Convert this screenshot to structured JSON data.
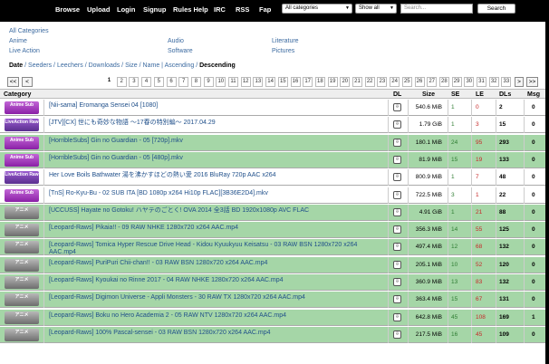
{
  "nav": {
    "items": [
      "Browse",
      "Upload",
      "Login",
      "Signup",
      "Rules Help",
      "IRC",
      "RSS",
      "Fap"
    ],
    "category_select": "All categories",
    "filter_select": "Show all",
    "search_placeholder": "Search...",
    "search_button": "Search"
  },
  "categories": {
    "all": "All Categories",
    "anime": "Anime",
    "audio": "Audio",
    "literature": "Literature",
    "live_action": "Live Action",
    "software": "Software",
    "pictures": "Pictures"
  },
  "sort": {
    "date": "Date",
    "seeders": "Seeders",
    "leechers": "Leechers",
    "downloads": "Downloads",
    "size": "Size",
    "name": "Name",
    "ascending": "Ascending",
    "descending": "Descending"
  },
  "pager": {
    "first": "<<",
    "prev": "<",
    "next": ">",
    "last": ">>",
    "pages": [
      "1",
      "2",
      "3",
      "4",
      "5",
      "6",
      "7",
      "8",
      "9",
      "10",
      "11",
      "12",
      "13",
      "14",
      "15",
      "16",
      "17",
      "18",
      "19",
      "20",
      "21",
      "22",
      "23",
      "24",
      "25",
      "26",
      "27",
      "28",
      "29",
      "30",
      "31",
      "32",
      "33"
    ]
  },
  "table": {
    "headers": {
      "category": "Category",
      "dl": "DL",
      "size": "Size",
      "se": "SE",
      "le": "LE",
      "dls": "DLs",
      "msg": "Msg"
    },
    "rows": [
      {
        "badge": "Anime Sub",
        "color": "pink",
        "name": "[Nii-sama] Eromanga Sensei 04 [1080]",
        "size": "540.6 MiB",
        "se": "1",
        "le": "0",
        "dls": "2",
        "msg": "0",
        "bg": "w"
      },
      {
        "badge": "LiveAction Raw",
        "color": "purple",
        "name": "[JTV][CX] 世にも奇妙な物語 ～17春の特別編～ 2017.04.29",
        "size": "1.79 GiB",
        "se": "1",
        "le": "3",
        "dls": "15",
        "msg": "0",
        "bg": "w"
      },
      {
        "badge": "Anime Sub",
        "color": "pink",
        "name": "[HorribleSubs] Gin no Guardian - 05 [720p].mkv",
        "size": "180.1 MiB",
        "se": "24",
        "le": "95",
        "dls": "293",
        "msg": "0",
        "bg": "g"
      },
      {
        "badge": "Anime Sub",
        "color": "pink",
        "name": "[HorribleSubs] Gin no Guardian - 05 [480p].mkv",
        "size": "81.9 MiB",
        "se": "15",
        "le": "19",
        "dls": "133",
        "msg": "0",
        "bg": "g"
      },
      {
        "badge": "LiveAction Raw",
        "color": "purple",
        "name": "Her Love Boils Bathwater 湯を沸かすほどの熱い愛 2016 BluRay 720p AAC x264",
        "size": "800.9 MiB",
        "se": "1",
        "le": "7",
        "dls": "48",
        "msg": "0",
        "bg": "w"
      },
      {
        "badge": "Anime Sub",
        "color": "pink",
        "name": "[TnS] Ro-Kyu-Bu - 02 SUB ITA [BD 1080p x264 Hi10p FLAC][3B36E2D4].mkv",
        "size": "722.5 MiB",
        "se": "3",
        "le": "1",
        "dls": "22",
        "msg": "0",
        "bg": "w"
      },
      {
        "badge": "アニメ",
        "color": "gray",
        "name": "[UCCUSS] Hayate no Gotoku! ハヤテのごとく! OVA 2014 全3話 BD 1920x1080p AVC FLAC",
        "size": "4.91 GiB",
        "se": "1",
        "le": "21",
        "dls": "88",
        "msg": "0",
        "bg": "g"
      },
      {
        "badge": "アニメ",
        "color": "gray",
        "name": "[Leopard-Raws] Pikaia!! - 09 RAW NHKE 1280x720 x264 AAC.mp4",
        "size": "356.3 MiB",
        "se": "14",
        "le": "55",
        "dls": "125",
        "msg": "0",
        "bg": "g"
      },
      {
        "badge": "アニメ",
        "color": "gray",
        "name": "[Leopard-Raws] Tomica Hyper Rescue Drive Head - Kidou Kyuukyuu Keisatsu - 03 RAW BSN 1280x720 x264 AAC.mp4",
        "size": "497.4 MiB",
        "se": "12",
        "le": "68",
        "dls": "132",
        "msg": "0",
        "bg": "g"
      },
      {
        "badge": "アニメ",
        "color": "gray",
        "name": "[Leopard-Raws] PuriPuri Chii-chan!! - 03 RAW BSN 1280x720 x264 AAC.mp4",
        "size": "205.1 MiB",
        "se": "10",
        "le": "52",
        "dls": "120",
        "msg": "0",
        "bg": "g"
      },
      {
        "badge": "アニメ",
        "color": "gray",
        "name": "[Leopard-Raws] Kyoukai no Rinne 2017 - 04 RAW NHKE 1280x720 x264 AAC.mp4",
        "size": "360.9 MiB",
        "se": "13",
        "le": "83",
        "dls": "132",
        "msg": "0",
        "bg": "g"
      },
      {
        "badge": "アニメ",
        "color": "gray",
        "name": "[Leopard-Raws] Digimon Universe - Appli Monsters - 30 RAW TX 1280x720 x264 AAC.mp4",
        "size": "363.4 MiB",
        "se": "15",
        "le": "67",
        "dls": "131",
        "msg": "0",
        "bg": "g"
      },
      {
        "badge": "アニメ",
        "color": "gray",
        "name": "[Leopard-Raws] Boku no Hero Academia 2 - 05 RAW NTV 1280x720 x264 AAC.mp4",
        "size": "642.8 MiB",
        "se": "45",
        "le": "108",
        "dls": "169",
        "msg": "1",
        "bg": "g"
      },
      {
        "badge": "アニメ",
        "color": "gray",
        "name": "[Leopard-Raws] 100% Pascal-sensei - 03 RAW BSN 1280x720 x264 AAC.mp4",
        "size": "217.5 MiB",
        "se": "16",
        "le": "45",
        "dls": "109",
        "msg": "0",
        "bg": "g"
      }
    ]
  }
}
